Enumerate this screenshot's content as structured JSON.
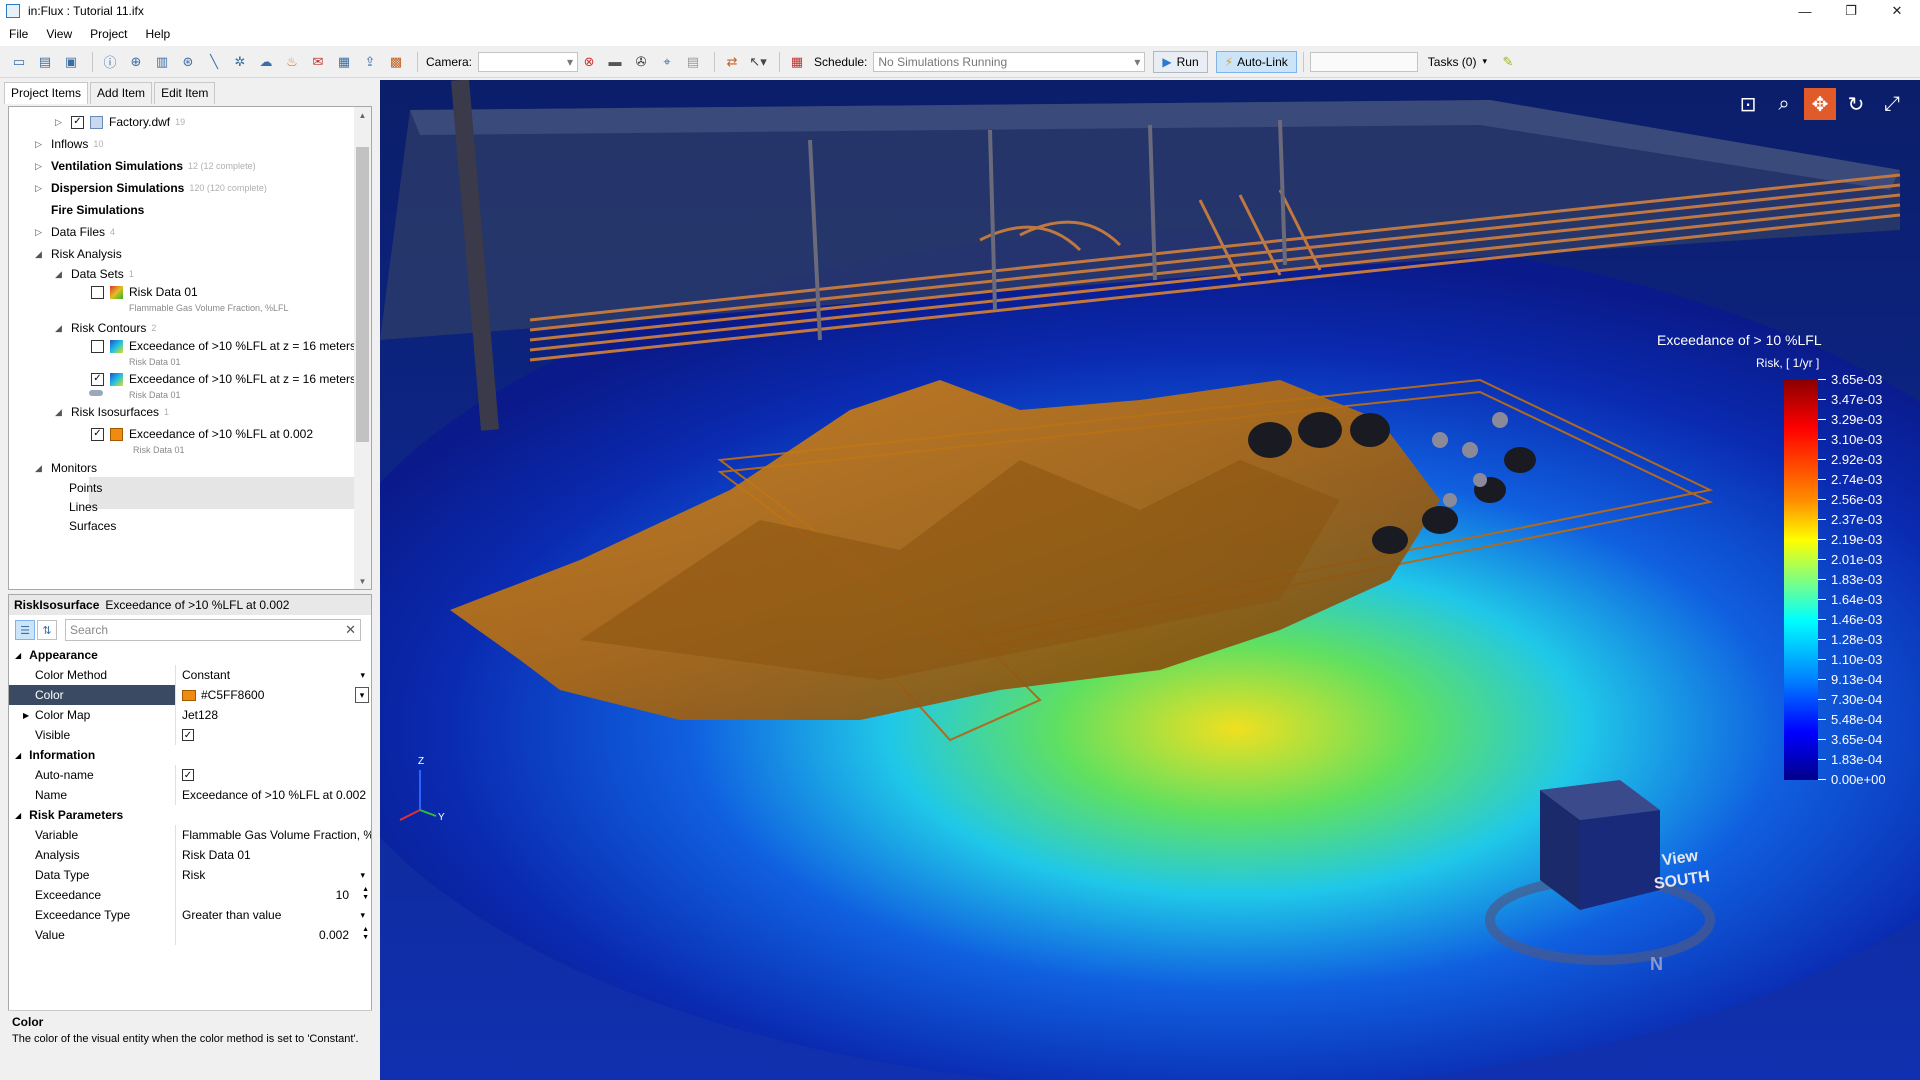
{
  "window": {
    "title": "in:Flux : Tutorial 11.ifx",
    "controls": [
      "—",
      "❐",
      "✕"
    ]
  },
  "menu": [
    "File",
    "View",
    "Project",
    "Help"
  ],
  "toolbar": {
    "camera_label": "Camera:",
    "camera_value": "",
    "schedule_label": "Schedule:",
    "schedule_value": "No Simulations Running",
    "run_label": "Run",
    "autolink_label": "Auto-Link",
    "tasks_label": "Tasks (0)"
  },
  "tabs": [
    "Project Items",
    "Add Item",
    "Edit Item"
  ],
  "tree": {
    "factory": "Factory.dwf",
    "factory_count": "19",
    "inflows": "Inflows",
    "inflows_count": "10",
    "vent": "Ventilation Simulations",
    "vent_count": "12 (12 complete)",
    "disp": "Dispersion Simulations",
    "disp_count": "120 (120 complete)",
    "fire": "Fire Simulations",
    "datafiles": "Data Files",
    "datafiles_count": "4",
    "risk": "Risk Analysis",
    "datasets": "Data Sets",
    "datasets_count": "1",
    "riskdata": "Risk Data 01",
    "riskdata_sub": "Flammable Gas Volume Fraction, %LFL",
    "contours": "Risk Contours",
    "contours_count": "2",
    "contour1": "Exceedance of >10 %LFL at z = 16 meters",
    "contour1_sub": "Risk Data 01",
    "contour2": "Exceedance of >10 %LFL at z = 16 meters",
    "contour2_sub": "Risk Data 01",
    "iso": "Risk Isosurfaces",
    "iso_count": "1",
    "iso1": "Exceedance of >10 %LFL at 0.002",
    "iso1_sub": "Risk Data 01",
    "monitors": "Monitors",
    "points": "Points",
    "lines": "Lines",
    "surfaces": "Surfaces"
  },
  "props": {
    "head_type": "RiskIsosurface",
    "head_name": "Exceedance of >10 %LFL at 0.002",
    "search_placeholder": "Search",
    "appearance": "Appearance",
    "color_method_k": "Color Method",
    "color_method_v": "Constant",
    "color_k": "Color",
    "color_v": "#C5FF8600",
    "colormap_k": "Color Map",
    "colormap_v": "Jet128",
    "visible_k": "Visible",
    "information": "Information",
    "autoname_k": "Auto-name",
    "name_k": "Name",
    "name_v": "Exceedance of >10 %LFL at 0.002",
    "risk_params": "Risk Parameters",
    "variable_k": "Variable",
    "variable_v": "Flammable Gas Volume Fraction, %LF",
    "analysis_k": "Analysis",
    "analysis_v": "Risk Data 01",
    "datatype_k": "Data Type",
    "datatype_v": "Risk",
    "exceedance_k": "Exceedance",
    "exceedance_v": "10",
    "exctype_k": "Exceedance Type",
    "exctype_v": "Greater than value",
    "value_k": "Value",
    "value_v": "0.002"
  },
  "description": {
    "title": "Color",
    "text": "The color of the visual entity when the color method is set to 'Constant'."
  },
  "legend": {
    "title": "Exceedance of > 10 %LFL",
    "unit": "Risk, [ 1/yr ]",
    "labels": [
      "3.65e-03",
      "3.47e-03",
      "3.29e-03",
      "3.10e-03",
      "2.92e-03",
      "2.74e-03",
      "2.56e-03",
      "2.37e-03",
      "2.19e-03",
      "2.01e-03",
      "1.83e-03",
      "1.64e-03",
      "1.46e-03",
      "1.28e-03",
      "1.10e-03",
      "9.13e-04",
      "7.30e-04",
      "5.48e-04",
      "3.65e-04",
      "1.83e-04",
      "0.00e+00"
    ]
  },
  "viewcube": {
    "line1": "View",
    "line2": "SOUTH",
    "axis_z": "Z",
    "axis_y": "Y",
    "compass_n": "N"
  },
  "colors": {
    "accent": "#e05a2a",
    "iso_color": "#C5FF8600"
  }
}
